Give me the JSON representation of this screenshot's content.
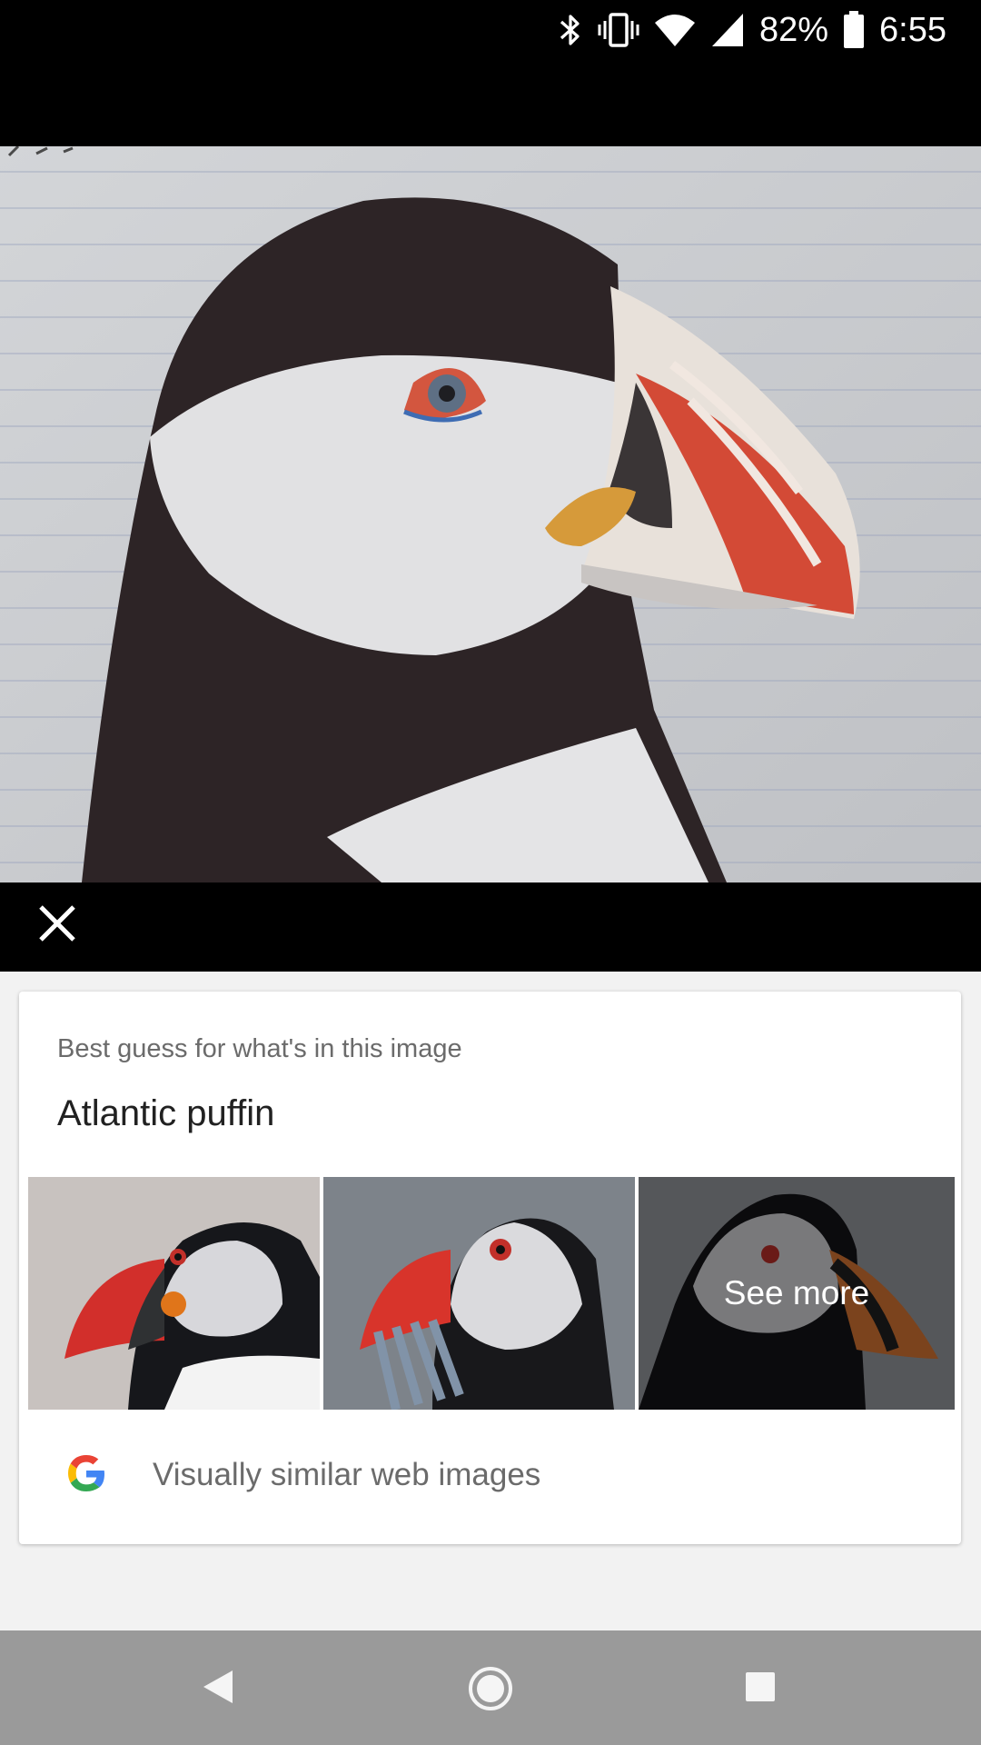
{
  "status_bar": {
    "battery_percent": "82%",
    "time": "6:55",
    "icons": [
      "bluetooth-icon",
      "vibrate-icon",
      "wifi-icon",
      "cell-signal-icon",
      "battery-icon"
    ]
  },
  "viewer": {
    "image": "puffin-drawing",
    "close_icon": "close-icon"
  },
  "card": {
    "subtitle": "Best guess for what's in this image",
    "title": "Atlantic puffin",
    "thumbnails": [
      {
        "image": "puffin-photo"
      },
      {
        "image": "puffin-with-fish-photo"
      },
      {
        "image": "puffin-photo-more",
        "overlay_label": "See more"
      }
    ],
    "similar": {
      "icon": "google-icon",
      "label": "Visually similar web images"
    }
  },
  "nav_bar": {
    "buttons": [
      "back-icon",
      "home-icon",
      "recents-icon"
    ]
  }
}
